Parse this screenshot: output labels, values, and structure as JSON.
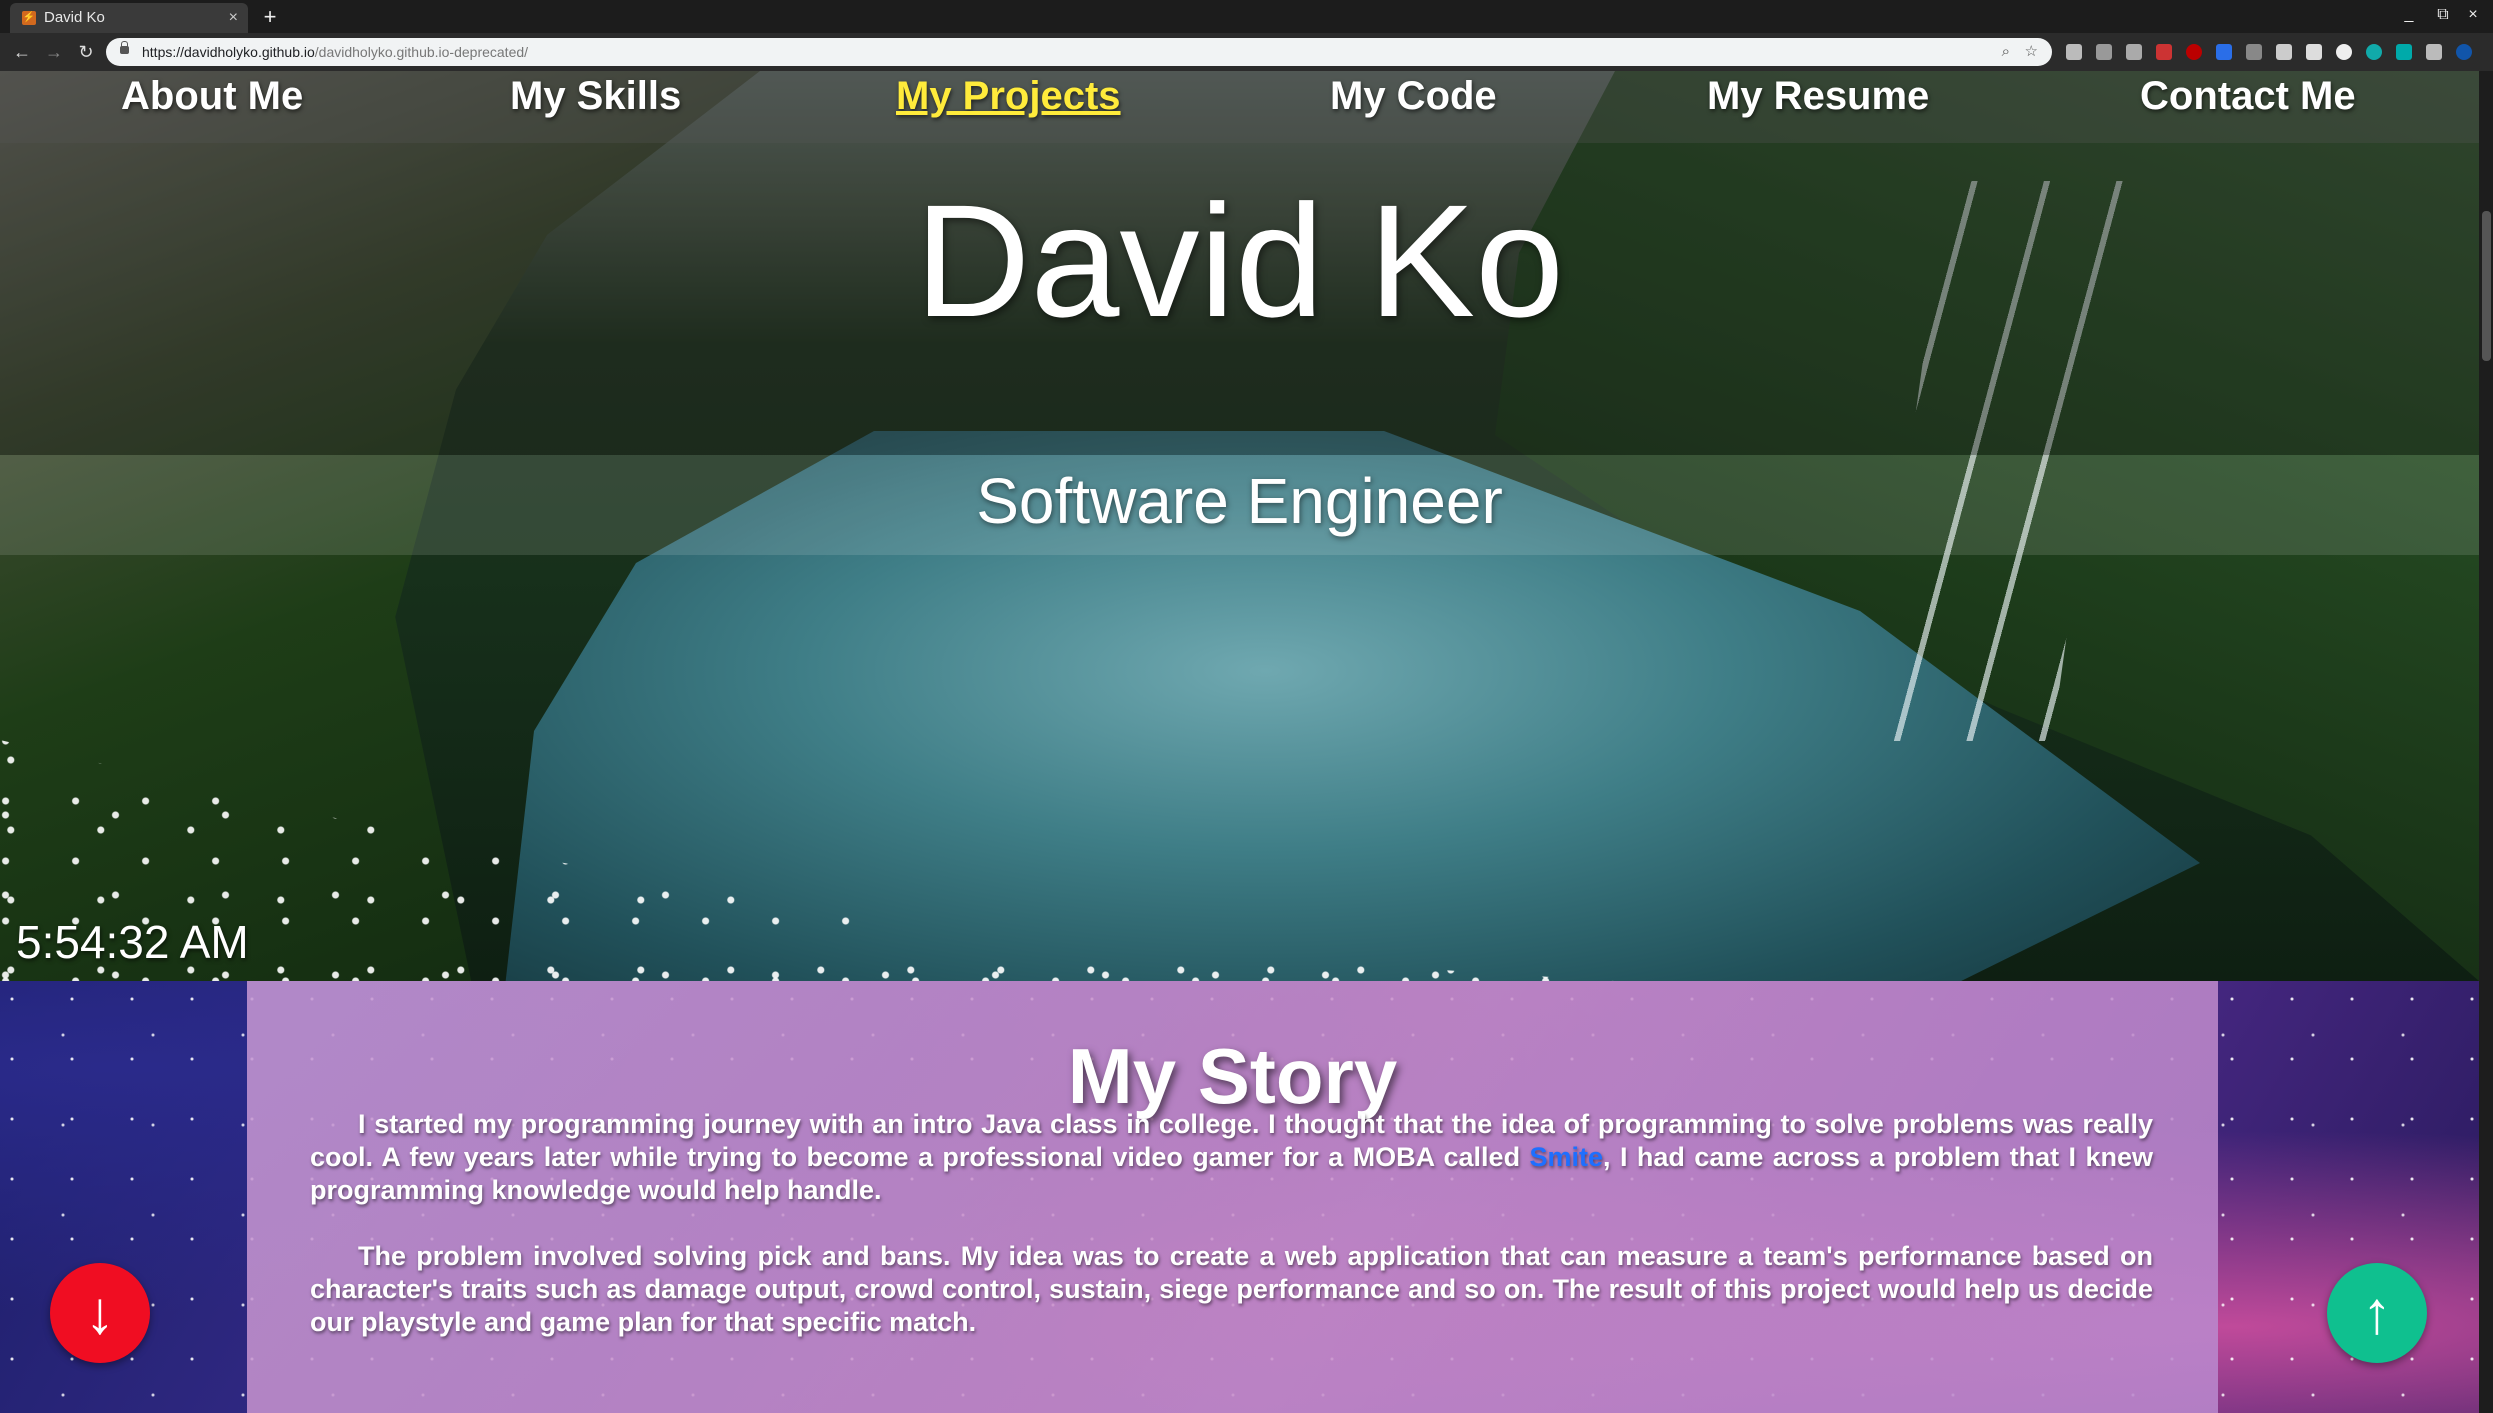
{
  "browser": {
    "tab_title": "David Ko",
    "tab_close": "×",
    "new_tab": "+",
    "url_host": "https://davidholyko.github.io",
    "url_path": "/davidholyko.github.io-deprecated/",
    "window_controls": [
      "_",
      "⧉",
      "×"
    ]
  },
  "nav": {
    "items": [
      "About Me",
      "My Skills",
      "My Projects",
      "My Code",
      "My Resume",
      "Contact Me"
    ],
    "active": "My Projects"
  },
  "hero": {
    "name": "David Ko",
    "subtitle": "Software Engineer",
    "clock": "5:54:32 AM"
  },
  "story": {
    "title": "My Story",
    "para1_before": "I started my programming journey with an intro Java class in college. I thought that the idea of programming to solve problems was really cool. A few years later while trying to become a professional video gamer for a MOBA called ",
    "para1_link": "Smite",
    "para1_after": ", I had came across a problem that I knew programming knowledge would help handle.",
    "para2": "The problem involved solving pick and bans. My idea was to create a web application that can measure a team's performance based on character's traits such as damage output, crowd control, sustain, siege performance and so on. The result of this project would help us decide our playstyle and game plan for that specific match."
  },
  "buttons": {
    "scroll_down": "↓",
    "scroll_up": "↑"
  },
  "colors": {
    "active_nav": "#ffeb3b",
    "link": "#1e6fff",
    "scroll_down_button": "#f00d22",
    "scroll_up_button": "#0fc08f"
  }
}
